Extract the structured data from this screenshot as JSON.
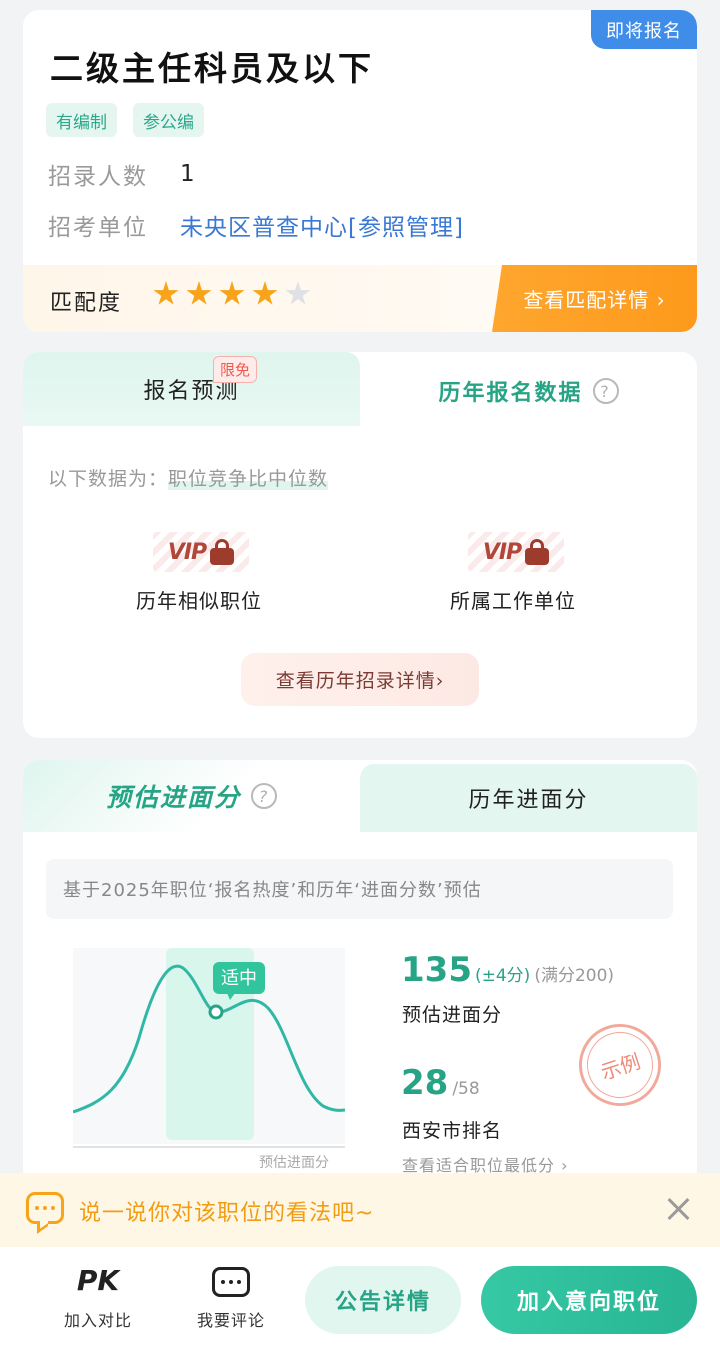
{
  "position": {
    "status_badge": "即将报名",
    "title": "二级主任科员及以下",
    "tags": [
      "有编制",
      "参公编"
    ],
    "recruit_label": "招录人数",
    "recruit_value": "1",
    "unit_label": "招考单位",
    "unit_value": "未央区普查中心[参照管理]",
    "match_label": "匹配度",
    "match_stars": 4,
    "match_stars_max": 5,
    "match_button": "查看匹配详情 ›"
  },
  "registration": {
    "tab_predict": "报名预测",
    "tab_predict_badge": "限免",
    "tab_history": "历年报名数据",
    "help_icon": "?",
    "note_prefix": "以下数据为：",
    "note_highlight": "职位竞争比中位数",
    "vip_text": "VIP",
    "vip_items": [
      "历年相似职位",
      "所属工作单位"
    ],
    "history_button": "查看历年招录详情›"
  },
  "score": {
    "tab_estimate": "预估进面分",
    "tab_history": "历年进面分",
    "basis": "基于2025年职位‘报名热度’和历年‘进面分数’预估",
    "curve_tag": "适中",
    "curve_caption": "预估进面分",
    "score_value": "135",
    "score_range": "(±4分)",
    "score_full": "(满分200)",
    "score_label": "预估进面分",
    "rank_value": "28",
    "rank_total": "/58",
    "rank_label": "西安市排名",
    "stamp": "示例",
    "low_link": "查看适合职位最低分 ›"
  },
  "comment": {
    "prompt": "说一说你对该职位的看法吧~"
  },
  "bottom_bar": {
    "pk_icon_text": "PK",
    "compare_label": "加入对比",
    "comment_label": "我要评论",
    "notice_button": "公告详情",
    "join_button": "加入意向职位"
  },
  "colors": {
    "accent_green": "#27a486",
    "accent_orange": "#f7a41b",
    "badge_blue": "#3f8de8",
    "link_blue": "#3a78d4"
  },
  "icons": [
    "star-icon",
    "question-icon",
    "lock-icon",
    "chat-bubble-icon",
    "close-icon",
    "pk-icon",
    "comment-icon"
  ]
}
